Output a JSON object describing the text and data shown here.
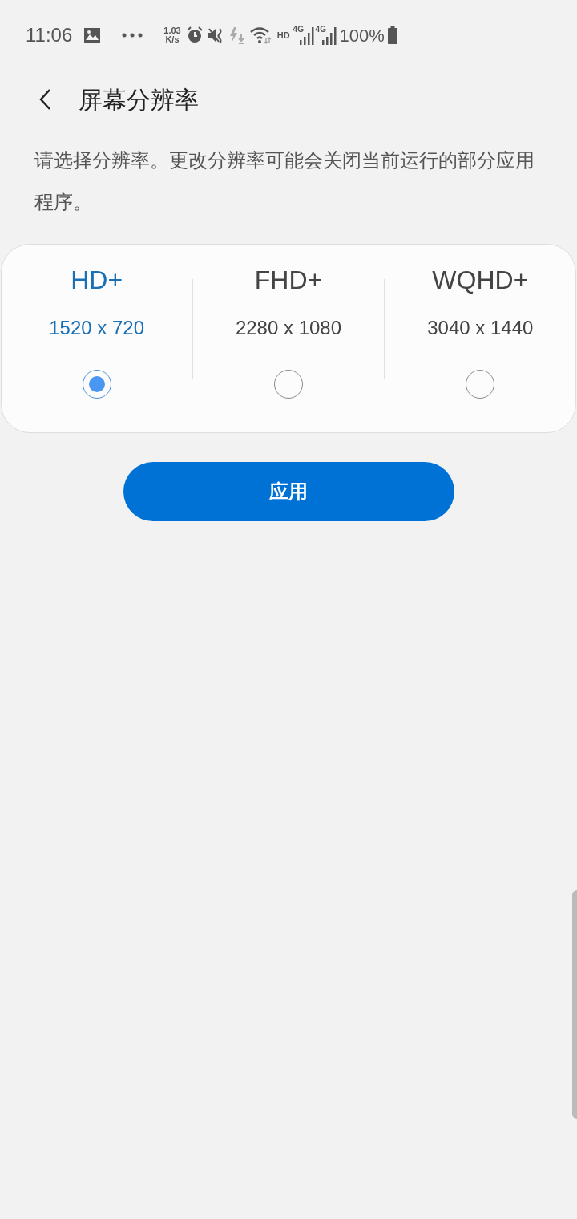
{
  "status_bar": {
    "time": "11:06",
    "speed_value": "1.03",
    "speed_unit": "K/s",
    "hd": "HD",
    "networks": [
      "4G",
      "4G"
    ],
    "battery": "100%"
  },
  "header": {
    "title": "屏幕分辨率"
  },
  "description": "请选择分辨率。更改分辨率可能会关闭当前运行的部分应用程序。",
  "options": [
    {
      "label": "HD+",
      "resolution": "1520 x 720",
      "selected": true
    },
    {
      "label": "FHD+",
      "resolution": "2280 x 1080",
      "selected": false
    },
    {
      "label": "WQHD+",
      "resolution": "3040 x 1440",
      "selected": false
    }
  ],
  "apply_button": "应用"
}
